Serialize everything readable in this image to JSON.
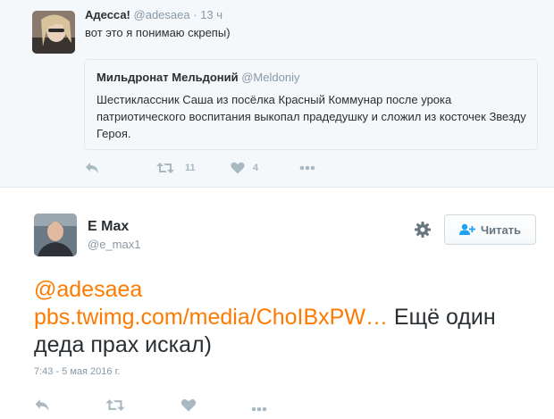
{
  "parent_tweet": {
    "author_name": "Адесса!",
    "author_handle": "@adesaea",
    "separator": "·",
    "time": "13 ч",
    "text": "вот это я понимаю скрепы)",
    "quoted": {
      "author_name": "Мильдронат Мельдоний",
      "author_handle": "@Meldoniy",
      "text": "Шестиклассник Саша из посёлка Красный Коммунар после урока патриотического воспитания выкопал прадедушку и сложил из косточек Звезду Героя."
    },
    "actions": {
      "retweet_count": "11",
      "like_count": "4"
    }
  },
  "main_tweet": {
    "author_name": "E Max",
    "author_handle": "@e_max1",
    "follow_label": "Читать",
    "mention": "@adesaea",
    "link": "pbs.twimg.com/media/ChoIBxPW…",
    "text": " Ещё один деда прах искал)",
    "timestamp": "7:43 - 5 мая 2016 г."
  },
  "colors": {
    "link": "#ff7a00",
    "muted": "#8899a6",
    "icon": "#aab8c2",
    "text": "#292f33"
  }
}
